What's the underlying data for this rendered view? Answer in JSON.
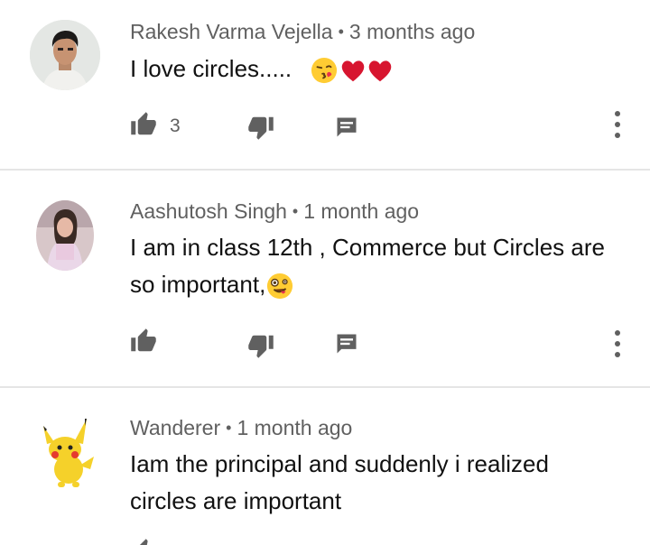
{
  "comments": [
    {
      "author": "Rakesh Varma Vejella",
      "time": "3 months ago",
      "text": "I love circles.....",
      "emoji_names": [
        "kissing-face-emoji",
        "red-heart-emoji",
        "red-heart-emoji"
      ],
      "like_count": "3"
    },
    {
      "author": "Aashutosh Singh",
      "time": "1 month ago",
      "text": "I am in class 12th , Commerce but Circles are so important,",
      "emoji_names": [
        "zany-face-emoji"
      ],
      "like_count": ""
    },
    {
      "author": "Wanderer",
      "time": "1 month ago",
      "text": "Iam the principal and suddenly i realized circles are important",
      "emoji_names": [],
      "like_count": ""
    }
  ],
  "separator": "•",
  "colors": {
    "meta": "#606060",
    "icon": "#606060",
    "divider": "#e5e5e5"
  }
}
